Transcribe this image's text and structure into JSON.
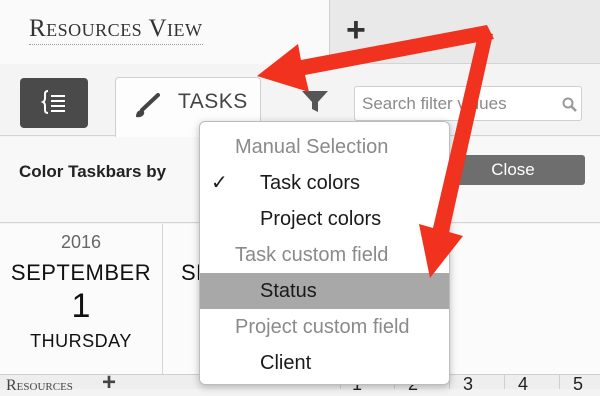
{
  "view_tab": {
    "title": "Resources View",
    "add_label": "+"
  },
  "toolbar": {
    "tasks_label": "TASKS",
    "search_placeholder": "Search filter values"
  },
  "color_bar": {
    "label": "Color Taskbars by",
    "close_label": "Close"
  },
  "calendar": {
    "year": "2016",
    "month": "SEPTEMBER",
    "day": "1",
    "weekday": "THURSDAY",
    "next_month_partial": "SE",
    "resources_label": "Resources",
    "resources_add": "+",
    "day_numbers": [
      "1",
      "2",
      "3",
      "4",
      "5"
    ]
  },
  "dropdown": {
    "sections": [
      {
        "header": "Manual Selection"
      },
      {
        "item": "Task colors",
        "checked": true
      },
      {
        "item": "Project colors"
      },
      {
        "header": "Task custom field"
      },
      {
        "item": "Status",
        "highlighted": true
      },
      {
        "header": "Project custom field"
      },
      {
        "item": "Client"
      }
    ],
    "check_mark": "✓"
  },
  "annotation": {
    "arrow_color": "#f0321e"
  },
  "colors": {
    "dark_button": "#4a4a4a",
    "close_button": "#6e6e6e",
    "highlight": "#a8a8a8"
  }
}
